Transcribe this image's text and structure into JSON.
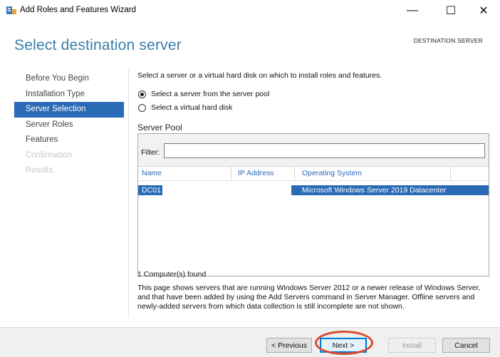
{
  "window": {
    "title": "Add Roles and Features Wizard",
    "icon": "server-manager-icon",
    "minimize_glyph": "—",
    "maximize_glyph": "☐",
    "close_glyph": "✕"
  },
  "header": {
    "title": "Select destination server",
    "destination_label": "DESTINATION SERVER"
  },
  "nav": {
    "items": [
      {
        "label": "Before You Begin",
        "state": "normal"
      },
      {
        "label": "Installation Type",
        "state": "normal"
      },
      {
        "label": "Server Selection",
        "state": "active"
      },
      {
        "label": "Server Roles",
        "state": "normal"
      },
      {
        "label": "Features",
        "state": "normal"
      },
      {
        "label": "Confirmation",
        "state": "disabled"
      },
      {
        "label": "Results",
        "state": "disabled"
      }
    ]
  },
  "content": {
    "intro": "Select a server or a virtual hard disk on which to install roles and features.",
    "radio_pool": "Select a server from the server pool",
    "radio_vhd": "Select a virtual hard disk",
    "selected_option": "pool",
    "pool_title": "Server Pool",
    "filter_label": "Filter:",
    "filter_value": "",
    "columns": [
      "Name",
      "IP Address",
      "Operating System"
    ],
    "rows": [
      {
        "name": "DC01",
        "ip": "",
        "os": "Microsoft Windows Server 2019 Datacenter",
        "selected": true
      }
    ],
    "found": "1 Computer(s) found",
    "description": "This page shows servers that are running Windows Server 2012 or a newer release of Windows Server, and that have been added by using the Add Servers command in Server Manager. Offline servers and newly-added servers from which data collection is still incomplete are not shown."
  },
  "footer": {
    "previous": "< Previous",
    "next": "Next >",
    "install": "Install",
    "cancel": "Cancel"
  },
  "colors": {
    "accent": "#2a6bb5",
    "title": "#3a7ea8",
    "highlight_circle": "#d9492e"
  }
}
